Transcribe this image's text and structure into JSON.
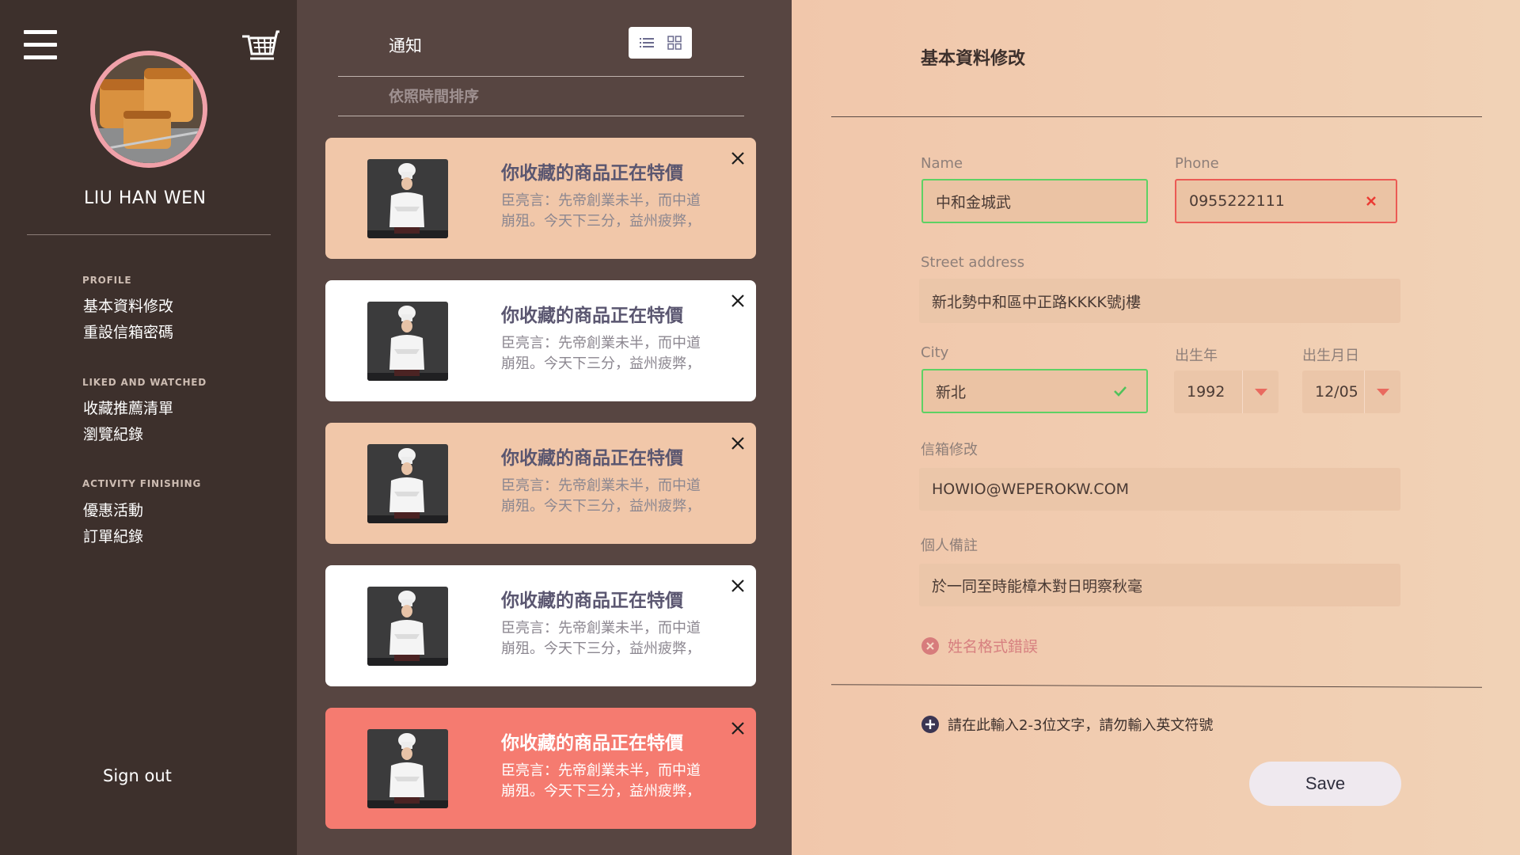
{
  "sidebar": {
    "user_name": "LIU HAN WEN",
    "sections": [
      {
        "heading": "PROFILE",
        "items": [
          "基本資料修改",
          "重設信箱密碼"
        ]
      },
      {
        "heading": "LIKED AND WATCHED",
        "items": [
          "收藏推薦清單",
          "瀏覽紀錄"
        ]
      },
      {
        "heading": "ACTIVITY FINISHING",
        "items": [
          "優惠活動",
          "訂單紀錄"
        ]
      }
    ],
    "sign_out": "Sign out"
  },
  "notifications": {
    "title": "通知",
    "sort_label": "依照時間排序",
    "view_modes": [
      "list-view-icon",
      "grid-view-icon"
    ],
    "cards": [
      {
        "title": "你收藏的商品正在特價",
        "body_1": "臣亮言：先帝創業未半，而中道",
        "body_2": "崩殂。今天下三分，益州疲弊，",
        "style": "peach"
      },
      {
        "title": "你收藏的商品正在特價",
        "body_1": "臣亮言：先帝創業未半，而中道",
        "body_2": "崩殂。今天下三分，益州疲弊，",
        "style": "white"
      },
      {
        "title": "你收藏的商品正在特價",
        "body_1": "臣亮言：先帝創業未半，而中道",
        "body_2": "崩殂。今天下三分，益州疲弊，",
        "style": "peach"
      },
      {
        "title": "你收藏的商品正在特價",
        "body_1": "臣亮言：先帝創業未半，而中道",
        "body_2": "崩殂。今天下三分，益州疲弊，",
        "style": "white"
      },
      {
        "title": "你收藏的商品正在特價",
        "body_1": "臣亮言：先帝創業未半，而中道",
        "body_2": "崩殂。今天下三分，益州疲弊，",
        "style": "coral"
      }
    ]
  },
  "form": {
    "title": "基本資料修改",
    "name": {
      "label": "Name",
      "value": "中和金城武",
      "state": "valid"
    },
    "phone": {
      "label": "Phone",
      "value": "0955222111",
      "state": "invalid"
    },
    "street": {
      "label": "Street address",
      "value": "新北勢中和區中正路KKKK號j樓"
    },
    "city": {
      "label": "City",
      "value": "新北",
      "state": "valid"
    },
    "birth_year": {
      "label": "出生年",
      "value": "1992"
    },
    "birth_date": {
      "label": "出生月日",
      "value": "12/05"
    },
    "email": {
      "label": "信箱修改",
      "value": "HOWIO@WEPEROKW.COM"
    },
    "note": {
      "label": "個人備註",
      "value": "於一同至時能樟木對日明察秋毫"
    },
    "error_message": "姓名格式錯誤",
    "hint": "請在此輸入2-3位文字，請勿輸入英文符號",
    "save_label": "Save"
  },
  "colors": {
    "sidebar_bg": "#3d302c",
    "panel_bg": "#574541",
    "card_peach": "#f1c7a9",
    "card_white": "#ffffff",
    "card_coral": "#f57b70",
    "valid": "#5ed164",
    "invalid": "#eb5a54",
    "form_bg": "#f1c7ab"
  }
}
